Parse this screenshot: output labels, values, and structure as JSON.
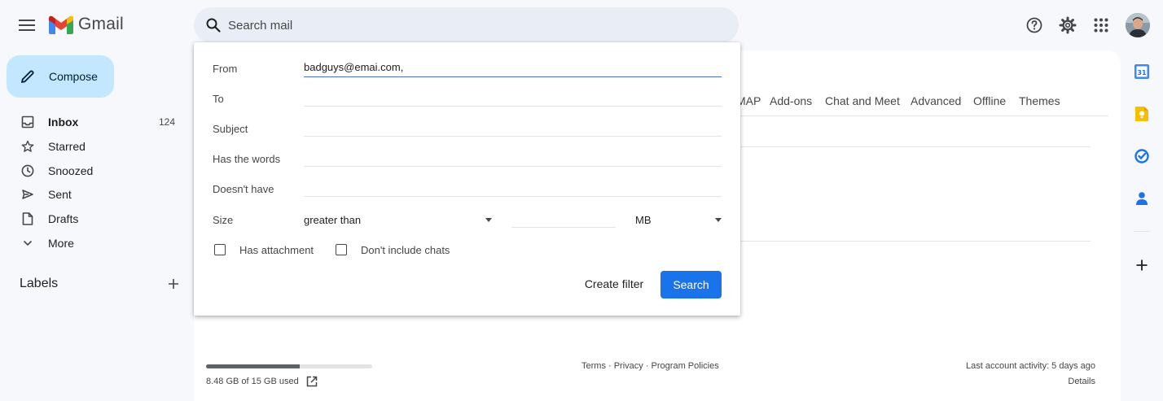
{
  "header": {
    "app_name": "Gmail",
    "search_placeholder": "Search mail"
  },
  "compose_label": "Compose",
  "nav": [
    {
      "label": "Inbox",
      "count": "124",
      "icon": "inbox-icon"
    },
    {
      "label": "Starred",
      "icon": "star-icon"
    },
    {
      "label": "Snoozed",
      "icon": "clock-icon"
    },
    {
      "label": "Sent",
      "icon": "send-icon"
    },
    {
      "label": "Drafts",
      "icon": "draft-icon"
    },
    {
      "label": "More",
      "icon": "chevron-down-icon"
    }
  ],
  "labels_heading": "Labels",
  "settings_tabs": [
    "MAP",
    "Add-ons",
    "Chat and Meet",
    "Advanced",
    "Offline",
    "Themes"
  ],
  "search_panel": {
    "from_label": "From",
    "from_value": "badguys@emai.com,",
    "to_label": "To",
    "subject_label": "Subject",
    "has_words_label": "Has the words",
    "doesnt_have_label": "Doesn't have",
    "size_label": "Size",
    "size_operator": "greater than",
    "size_unit": "MB",
    "has_attachment_label": "Has attachment",
    "no_chats_label": "Don't include chats",
    "create_filter_label": "Create filter",
    "search_label": "Search"
  },
  "footer": {
    "storage_text": "8.48 GB of 15 GB used",
    "storage_fraction": 0.565,
    "links": "Terms · Privacy · Program Policies",
    "last_activity": "Last account activity: 5 days ago",
    "details": "Details"
  },
  "colors": {
    "accent": "#1a73e8",
    "compose_bg": "#c2e7ff",
    "page_bg": "#f6f8fc"
  }
}
